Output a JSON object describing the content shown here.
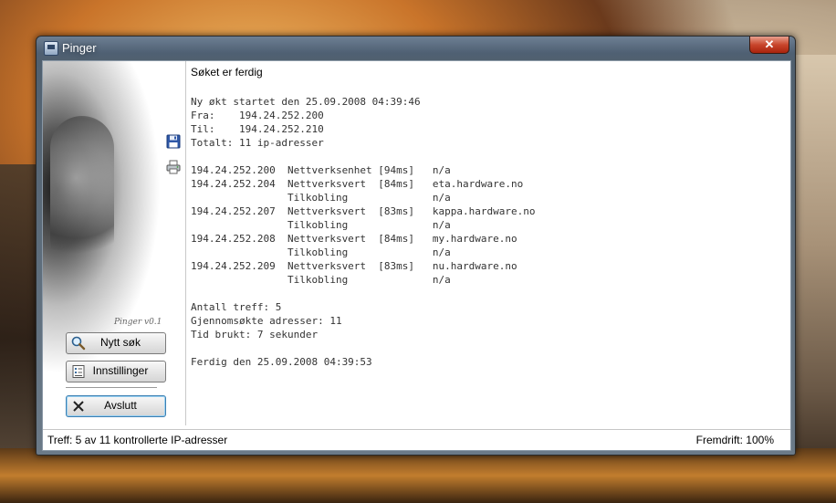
{
  "window": {
    "title": "Pinger",
    "close_label": "✕"
  },
  "sidebar": {
    "version": "Pinger v0.1",
    "buttons": {
      "new_search": "Nytt søk",
      "settings": "Innstillinger",
      "exit": "Avslutt"
    }
  },
  "main": {
    "status": "Søket er ferdig",
    "log_lines": [
      "Ny økt startet den 25.09.2008 04:39:46",
      "Fra:    194.24.252.200",
      "Til:    194.24.252.210",
      "Totalt: 11 ip-adresser",
      "",
      "194.24.252.200  Nettverksenhet [94ms]   n/a",
      "194.24.252.204  Nettverksvert  [84ms]   eta.hardware.no",
      "                Tilkobling              n/a",
      "194.24.252.207  Nettverksvert  [83ms]   kappa.hardware.no",
      "                Tilkobling              n/a",
      "194.24.252.208  Nettverksvert  [84ms]   my.hardware.no",
      "                Tilkobling              n/a",
      "194.24.252.209  Nettverksvert  [83ms]   nu.hardware.no",
      "                Tilkobling              n/a",
      "",
      "Antall treff: 5",
      "Gjennomsøkte adresser: 11",
      "Tid brukt: 7 sekunder",
      "",
      "Ferdig den 25.09.2008 04:39:53"
    ]
  },
  "statusbar": {
    "left": "Treff: 5 av 11 kontrollerte IP-adresser",
    "right": "Fremdrift: 100%"
  },
  "icons": {
    "app": "app-window-icon",
    "close": "close-icon",
    "search": "magnifier-icon",
    "settings": "settings-list-icon",
    "exit": "x-icon",
    "save": "floppy-disk-icon",
    "print": "printer-icon"
  }
}
